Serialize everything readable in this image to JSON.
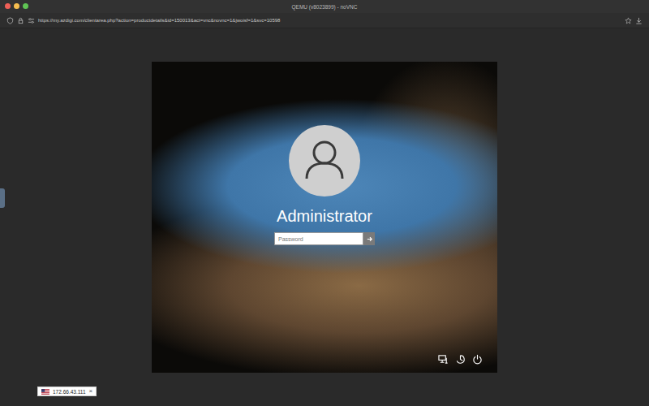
{
  "window": {
    "title": "QEMU (v8023899) - noVNC"
  },
  "address_bar": {
    "url": "https://my.azdigi.com/clientarea.php?action=productdetails&id=150013&act=vnc&novnc=1&jwoisf=1&svc=10598"
  },
  "login": {
    "user": "Administrator",
    "password": {
      "placeholder": "Password",
      "value": ""
    }
  },
  "status_pill": {
    "ip": "172.66.43.111",
    "close": "×"
  }
}
